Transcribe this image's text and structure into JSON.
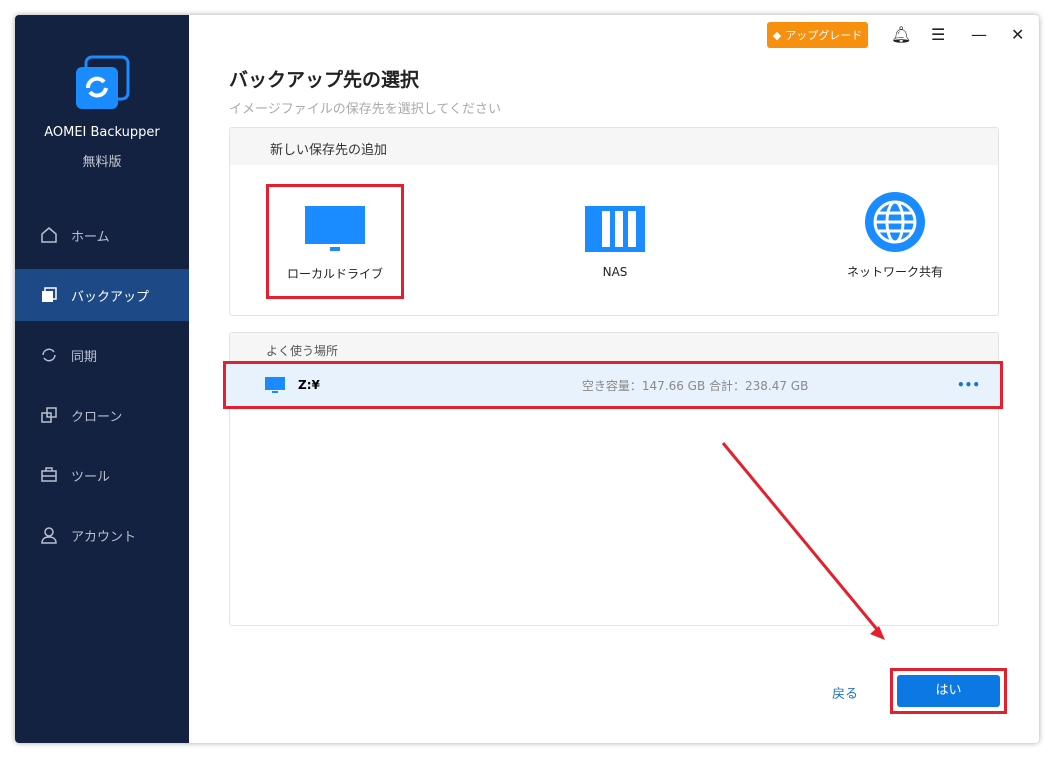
{
  "app": {
    "name": "AOMEI Backupper",
    "edition": "無料版"
  },
  "sidebar": {
    "items": [
      {
        "label": "ホーム"
      },
      {
        "label": "バックアップ"
      },
      {
        "label": "同期"
      },
      {
        "label": "クローン"
      },
      {
        "label": "ツール"
      },
      {
        "label": "アカウント"
      }
    ]
  },
  "toolbar": {
    "upgrade": "アップグレード"
  },
  "page": {
    "title": "バックアップ先の選択",
    "subtitle": "イメージファイルの保存先を選択してください"
  },
  "new_dest": {
    "header": "新しい保存先の追加",
    "options": [
      {
        "label": "ローカルドライブ"
      },
      {
        "label": "NAS"
      },
      {
        "label": "ネットワーク共有"
      }
    ]
  },
  "frequent": {
    "header": "よく使う場所",
    "items": [
      {
        "drive": "Z:¥",
        "capacity": "空き容量：147.66 GB 合計：238.47 GB"
      }
    ]
  },
  "footer": {
    "back": "戻る",
    "ok": "はい"
  }
}
